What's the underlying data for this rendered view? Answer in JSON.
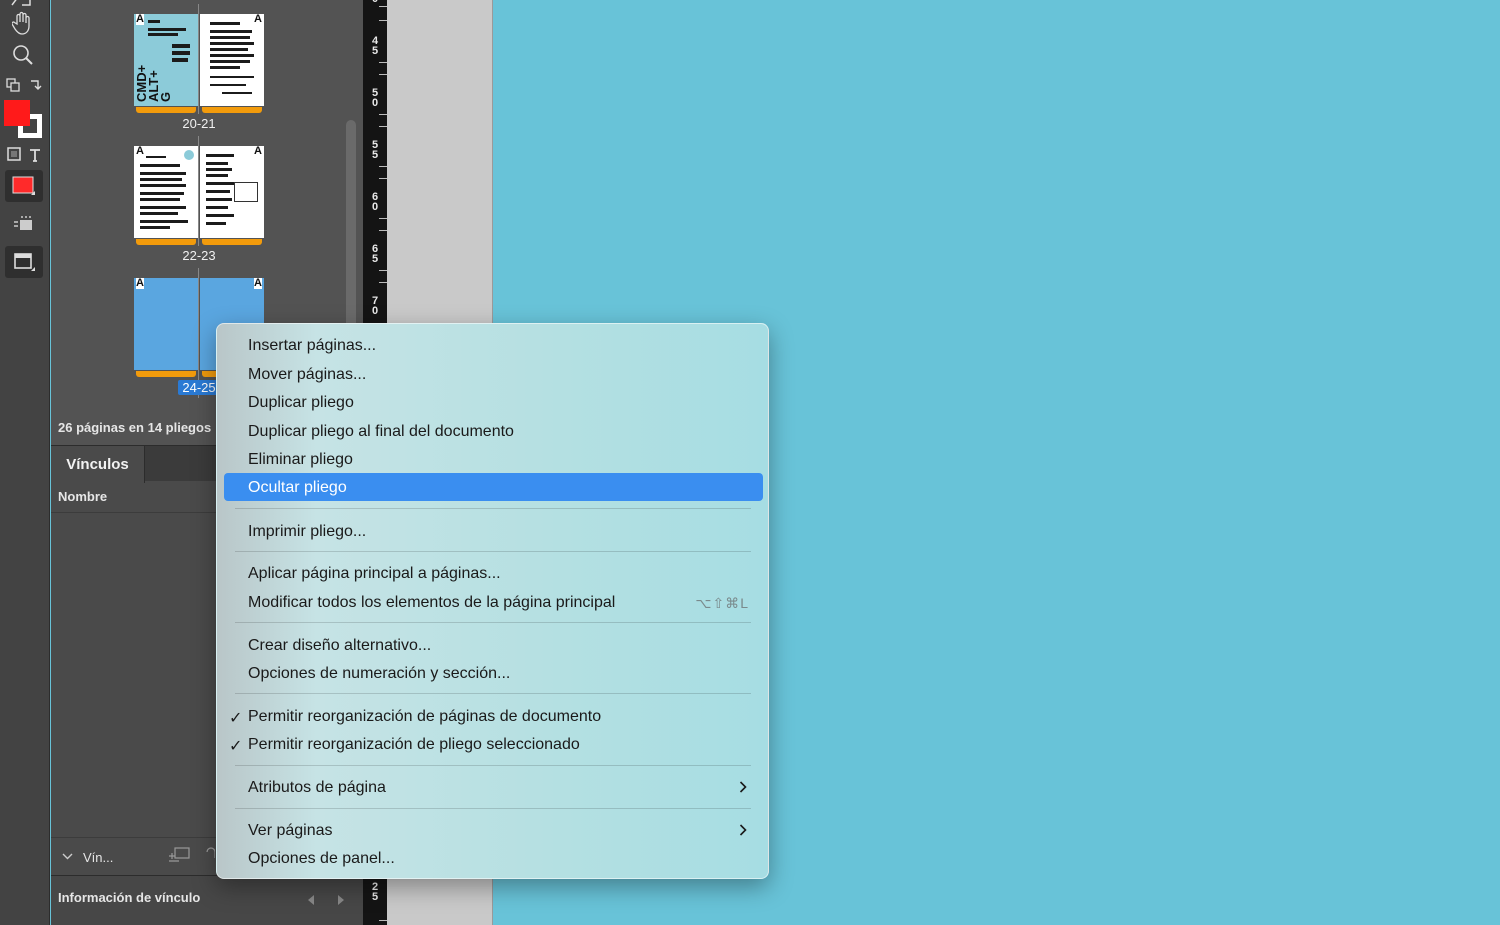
{
  "pages_panel": {
    "spreads": [
      {
        "label": "20-21",
        "page_tag_left": "A",
        "page_tag_right": "A",
        "cover_text": "CMD+\nALT+\nG"
      },
      {
        "label": "22-23",
        "page_tag_left": "A",
        "page_tag_right": "A"
      },
      {
        "label": "24-25",
        "page_tag_left": "A",
        "page_tag_right": "A"
      }
    ],
    "count_text": "26 páginas en 14 pliegos"
  },
  "links_panel": {
    "tab_label": "Vínculos",
    "column_header": "Nombre",
    "footer_label": "Vín...",
    "info_label": "Información de vínculo"
  },
  "ruler": {
    "labels": [
      "4\n5",
      "5\n0",
      "5\n5",
      "6\n0",
      "6\n5",
      "7\n0",
      "2\n5"
    ]
  },
  "context_menu": {
    "items": [
      {
        "label": "Insertar páginas..."
      },
      {
        "label": "Mover páginas..."
      },
      {
        "label": "Duplicar pliego"
      },
      {
        "label": "Duplicar pliego al final del documento"
      },
      {
        "label": "Eliminar pliego"
      },
      {
        "label": "Ocultar pliego",
        "highlighted": true
      },
      {
        "label": "Imprimir pliego..."
      },
      {
        "label": "Aplicar página principal a páginas..."
      },
      {
        "label": "Modificar todos los elementos de la página principal",
        "shortcut": "⌥⇧⌘L"
      },
      {
        "label": "Crear diseño alternativo..."
      },
      {
        "label": "Opciones de numeración y sección..."
      },
      {
        "label": "Permitir reorganización de páginas de documento",
        "checked": true,
        "check_mark": "✓"
      },
      {
        "label": "Permitir reorganización de pliego seleccionado",
        "checked": true,
        "check_mark": "✓"
      },
      {
        "label": "Atributos de página",
        "submenu": true
      },
      {
        "label": "Ver páginas",
        "submenu": true
      },
      {
        "label": "Opciones de panel..."
      }
    ]
  },
  "colors": {
    "canvas": "#68c3d8",
    "fill_swatch": "#ff1a1a",
    "highlight": "#3a8ef0",
    "spread_bar": "#f29b0c",
    "blank_page": "#5aa6e0"
  }
}
